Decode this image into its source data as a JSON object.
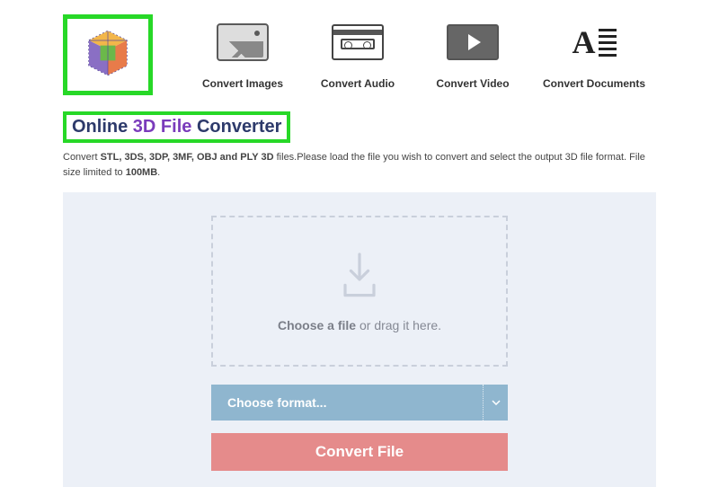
{
  "nav": {
    "images": "Convert Images",
    "audio": "Convert Audio",
    "video": "Convert Video",
    "documents": "Convert Documents"
  },
  "title": {
    "part1": "Online ",
    "part2": "3D File ",
    "part3": "Converter"
  },
  "subtitle": {
    "pre": "Convert ",
    "formats": "STL, 3DS, 3DP, 3MF, OBJ and PLY 3D",
    "mid": " files.Please load the file you wish to convert and select the output 3D file format. File size limited to ",
    "limit": "100MB",
    "post": "."
  },
  "dropzone": {
    "bold": "Choose a file",
    "rest": " or drag it here."
  },
  "format": {
    "placeholder": "Choose format..."
  },
  "convert": {
    "label": "Convert File"
  }
}
